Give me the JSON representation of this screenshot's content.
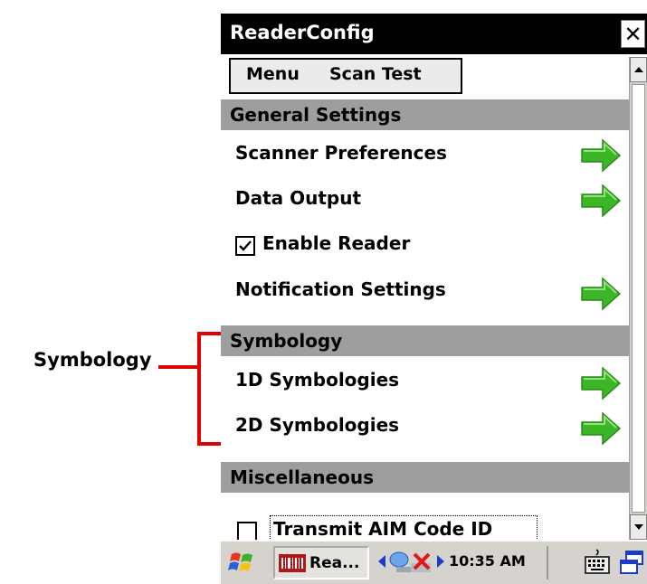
{
  "annotation": {
    "label": "Symbology"
  },
  "window": {
    "title": "ReaderConfig",
    "close_glyph": "✕"
  },
  "menubar": {
    "items": [
      "Menu",
      "Scan Test"
    ]
  },
  "sections": {
    "general": "General Settings",
    "symbology": "Symbology",
    "misc": "Miscellaneous"
  },
  "rows": {
    "scanner_preferences": "Scanner Preferences",
    "data_output": "Data Output",
    "enable_reader": {
      "label": "Enable Reader",
      "checked": true
    },
    "notification_settings": "Notification Settings",
    "symbologies_1d": "1D Symbologies",
    "symbologies_2d": "2D Symbologies",
    "transmit_aim": {
      "label": "Transmit AIM Code ID",
      "checked": false
    }
  },
  "taskbar": {
    "task_label": "Rea...",
    "clock": "10:35 AM"
  },
  "colors": {
    "arrow_green": "#3cb526",
    "section_bg": "#9e9e9e",
    "annotation_red": "#e00000",
    "titlebar_bg": "#000000"
  },
  "icons": [
    "windows-start-icon",
    "reader-app-icon",
    "network-icon",
    "network-error-icon",
    "keyboard-icon",
    "task-switch-icon",
    "green-arrow-icon"
  ]
}
